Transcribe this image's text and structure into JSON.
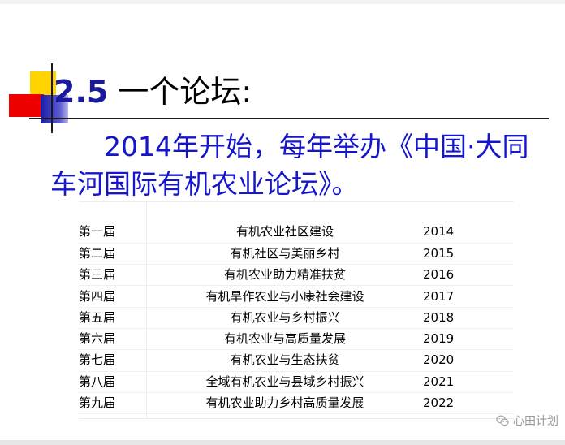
{
  "slide": {
    "title_number": "2.5",
    "title_text": " 一个论坛:",
    "body": "2014年开始，每年举办《中国·大同车河国际有机农业论坛》。"
  },
  "forum_table": {
    "rows": [
      {
        "session": "第一届",
        "theme": "有机农业社区建设",
        "year": "2014"
      },
      {
        "session": "第二届",
        "theme": "有机社区与美丽乡村",
        "year": "2015"
      },
      {
        "session": "第三届",
        "theme": "有机农业助力精准扶贫",
        "year": "2016"
      },
      {
        "session": "第四届",
        "theme": "有机旱作农业与小康社会建设",
        "year": "2017"
      },
      {
        "session": "第五届",
        "theme": "有机农业与乡村振兴",
        "year": "2018"
      },
      {
        "session": "第六届",
        "theme": "有机农业与高质量发展",
        "year": "2019"
      },
      {
        "session": "第七届",
        "theme": "有机农业与生态扶贫",
        "year": "2020"
      },
      {
        "session": "第八届",
        "theme": "全域有机农业与县域乡村振兴",
        "year": "2021"
      },
      {
        "session": "第九届",
        "theme": "有机农业助力乡村高质量发展",
        "year": "2022"
      }
    ]
  },
  "watermark": {
    "text": "心田计划",
    "icon": "wechat-icon"
  },
  "colors": {
    "title_number": "#1a1a9a",
    "body_text": "#1515cc",
    "deco_yellow": "#ffd400",
    "deco_red": "#ee0000",
    "deco_blue": "#1a1aa8"
  }
}
